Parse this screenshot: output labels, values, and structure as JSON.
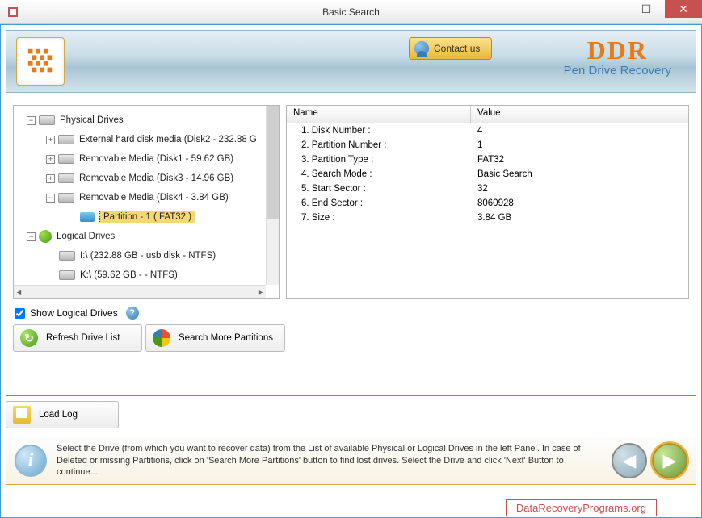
{
  "window": {
    "title": "Basic Search"
  },
  "header": {
    "contact_label": "Contact us",
    "brand_ddr": "DDR",
    "brand_sub": "Pen Drive Recovery"
  },
  "tree": {
    "physical_label": "Physical Drives",
    "logical_label": "Logical Drives",
    "physical": [
      {
        "label": "External hard disk media (Disk2 - 232.88 G",
        "expandable": true
      },
      {
        "label": "Removable Media (Disk1 - 59.62 GB)",
        "expandable": true
      },
      {
        "label": "Removable Media (Disk3 - 14.96 GB)",
        "expandable": true
      },
      {
        "label": "Removable Media (Disk4 - 3.84 GB)",
        "expandable": true,
        "expanded": true,
        "children": [
          {
            "label": "Partition - 1 ( FAT32 )",
            "selected": true
          }
        ]
      }
    ],
    "logical": [
      {
        "label": "I:\\ (232.88 GB - usb disk - NTFS)"
      },
      {
        "label": "K:\\ (59.62 GB -  - NTFS)"
      }
    ]
  },
  "props": {
    "col_name": "Name",
    "col_value": "Value",
    "rows": [
      {
        "name": "1. Disk Number :",
        "value": "4"
      },
      {
        "name": "2. Partition Number :",
        "value": "1"
      },
      {
        "name": "3. Partition Type :",
        "value": "FAT32"
      },
      {
        "name": "4. Search Mode :",
        "value": "Basic Search"
      },
      {
        "name": "5. Start Sector :",
        "value": "32"
      },
      {
        "name": "6. End Sector :",
        "value": "8060928"
      },
      {
        "name": "7. Size :",
        "value": "3.84 GB"
      }
    ]
  },
  "controls": {
    "show_logical_label": "Show Logical Drives",
    "refresh_label": "Refresh Drive List",
    "search_more_label": "Search More Partitions",
    "load_log_label": "Load Log"
  },
  "hint": {
    "text": "Select the Drive (from which you want to recover data) from the List of available Physical or Logical Drives in the left Panel. In case of Deleted or missing Partitions, click on 'Search More Partitions' button to find lost drives. Select the Drive and click 'Next' Button to continue..."
  },
  "footer": {
    "link": "DataRecoveryPrograms.org"
  }
}
